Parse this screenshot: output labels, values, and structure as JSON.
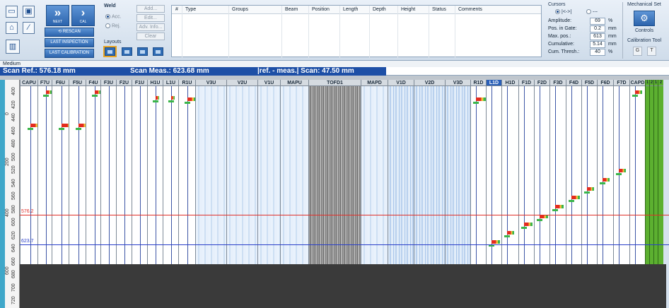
{
  "toolbar": {
    "rescan_label": "RESCAN",
    "last_inspection_label": "LAST INSPECTION",
    "last_calibration_label": "LAST CALIBRATION",
    "next_caption": "NEXT",
    "cal_caption": "CAL",
    "weld": {
      "title": "Weld",
      "acc_label": "Acc.",
      "rej_label": "Rej.",
      "add_label": "Add...",
      "edit_label": "Edit...",
      "adv_info_label": "Adv. Info...",
      "clear_label": "Clear"
    },
    "layouts_label": "Layouts"
  },
  "defect_table": {
    "headers": [
      "#",
      "Type",
      "Groups",
      "Beam",
      "Position",
      "Length",
      "Depth",
      "Height",
      "Status",
      "Comments"
    ]
  },
  "cursors": {
    "title": "Cursors",
    "mode_a": "|<->|",
    "mode_b": "---",
    "rows": [
      {
        "label": "Amplitude:",
        "value": "69",
        "unit": "%"
      },
      {
        "label": "Pos. in Gate:",
        "value": "0.2",
        "unit": "mm"
      },
      {
        "label": "Max. pos.:",
        "value": "613",
        "unit": "mm"
      },
      {
        "label": "Cumulative:",
        "value": "5.14",
        "unit": "mm"
      },
      {
        "label": "Cum. Thresh.:",
        "value": "40",
        "unit": "%"
      }
    ]
  },
  "mechanical": {
    "title": "Mechanical Set",
    "controls_label": "Controls",
    "calibration_tool_label": "Calibration Tool",
    "g_label": "G",
    "t_label": "T"
  },
  "medium_label": "Medium",
  "scan": {
    "ref": "Scan Ref.: 576.18 mm",
    "meas": "Scan Meas.: 623.68 mm",
    "diff": "|ref. - meas.| Scan: 47.50 mm"
  },
  "markers": {
    "ref_label": "576.2",
    "meas_label": "623.7"
  },
  "axis_ticks": [
    "400",
    "420",
    "440",
    "460",
    "480",
    "500",
    "520",
    "540",
    "560",
    "580",
    "600",
    "620",
    "640",
    "660",
    "680",
    "700",
    "720"
  ],
  "axis_side_ticks": [
    "0",
    "200",
    "400",
    "600"
  ],
  "columns": [
    "CAPU",
    "F7U",
    "F6U",
    "F5U",
    "F4U",
    "F3U",
    "F2U",
    "F1U",
    "H1U",
    "L1U",
    "R1U",
    "V3U",
    "V2U",
    "V1U",
    "MAPU",
    "TOFD1",
    "MAPD",
    "V1D",
    "V2D",
    "V3D",
    "R1D",
    "L1D",
    "H1D",
    "F1D",
    "F2D",
    "F3D",
    "F4D",
    "F5D",
    "F6D",
    "F7D",
    "CAPD",
    "1",
    "2",
    "1",
    "2"
  ],
  "colors": {
    "accent": "#1d4fa6",
    "ref_line": "#e0302a",
    "meas_line": "#2a3fc9",
    "indication": "#e32b1f",
    "gate_green": "#3bb54a"
  }
}
